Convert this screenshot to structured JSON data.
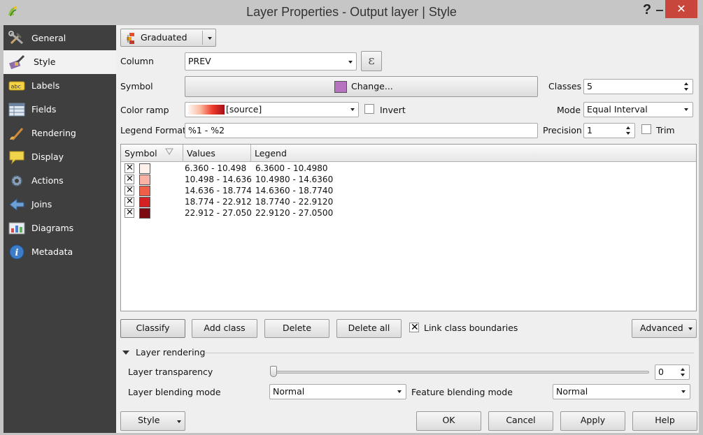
{
  "window": {
    "title": "Layer Properties - Output layer | Style",
    "help_glyph": "?",
    "close_glyph": "✕"
  },
  "sidebar": {
    "items": [
      {
        "label": "General",
        "icon": "wrench-hammer-icon"
      },
      {
        "label": "Style",
        "icon": "paintbrush-icon",
        "active": true
      },
      {
        "label": "Labels",
        "icon": "abc-label-icon"
      },
      {
        "label": "Fields",
        "icon": "table-fields-icon"
      },
      {
        "label": "Rendering",
        "icon": "brush-icon"
      },
      {
        "label": "Display",
        "icon": "speech-bubble-icon"
      },
      {
        "label": "Actions",
        "icon": "gear-icon"
      },
      {
        "label": "Joins",
        "icon": "join-arrow-icon"
      },
      {
        "label": "Diagrams",
        "icon": "chart-icon"
      },
      {
        "label": "Metadata",
        "icon": "info-icon"
      }
    ]
  },
  "renderer": {
    "value": "Graduated"
  },
  "column": {
    "label": "Column",
    "value": "PREV",
    "expression_glyph": "ε"
  },
  "symbol": {
    "label": "Symbol",
    "change_label": "Change...",
    "color": "#b873c0"
  },
  "classes": {
    "label": "Classes",
    "value": "5"
  },
  "color_ramp": {
    "label": "Color ramp",
    "value": "[source]",
    "invert_label": "Invert",
    "invert_checked": false
  },
  "mode": {
    "label": "Mode",
    "value": "Equal Interval"
  },
  "legend_format": {
    "label": "Legend Format",
    "value": "%1 - %2"
  },
  "precision": {
    "label": "Precision",
    "value": "1"
  },
  "trim": {
    "label": "Trim",
    "checked": false
  },
  "table": {
    "headers": [
      "Symbol",
      "Values",
      "Legend"
    ],
    "rows": [
      {
        "checked": true,
        "color": "#fef0eb",
        "values": "6.360 - 10.498",
        "legend": "6.3600 - 10.4980"
      },
      {
        "checked": true,
        "color": "#f9b2a3",
        "values": "10.498 - 14.636",
        "legend": "10.4980 - 14.6360"
      },
      {
        "checked": true,
        "color": "#f05e48",
        "values": "14.636 - 18.774",
        "legend": "14.6360 - 18.7740"
      },
      {
        "checked": true,
        "color": "#d42121",
        "values": "18.774 - 22.912",
        "legend": "18.7740 - 22.9120"
      },
      {
        "checked": true,
        "color": "#7c0a12",
        "values": "22.912 - 27.050",
        "legend": "22.9120 - 27.0500"
      }
    ]
  },
  "actions": {
    "classify": "Classify",
    "add_class": "Add class",
    "delete": "Delete",
    "delete_all": "Delete all",
    "link_boundaries": "Link class boundaries",
    "link_checked": true,
    "advanced": "Advanced"
  },
  "layer_rendering": {
    "title": "Layer rendering",
    "transparency_label": "Layer transparency",
    "transparency_value": "0",
    "blending_label": "Layer blending mode",
    "blending_value": "Normal",
    "feature_blending_label": "Feature blending mode",
    "feature_blending_value": "Normal"
  },
  "footer": {
    "style": "Style",
    "ok": "OK",
    "cancel": "Cancel",
    "apply": "Apply",
    "help": "Help"
  }
}
